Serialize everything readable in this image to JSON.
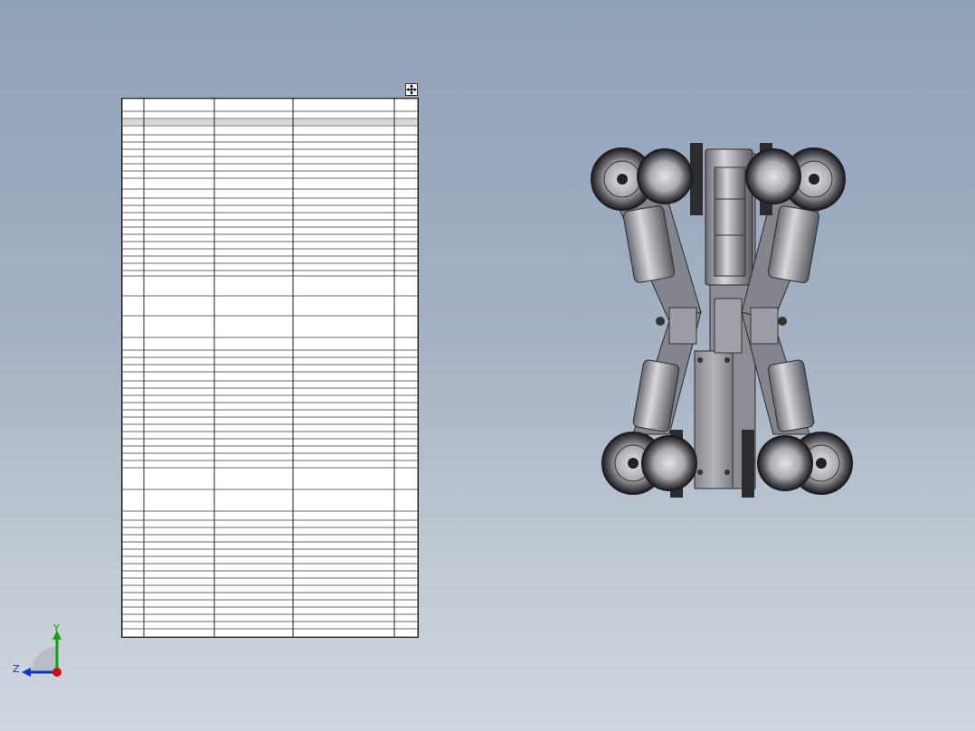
{
  "triad": {
    "x_label": "",
    "y_label": "Y",
    "z_label": "Z"
  },
  "bom": {
    "header": [
      "",
      "",
      "",
      "",
      ""
    ],
    "rows": [
      [
        "",
        "",
        "",
        "",
        ""
      ],
      [
        "",
        "",
        "",
        "",
        ""
      ],
      [
        "",
        "",
        "",
        "",
        ""
      ],
      [
        "",
        "",
        "",
        "",
        ""
      ],
      [
        "",
        "",
        "",
        "",
        ""
      ],
      [
        "",
        "",
        "",
        "",
        ""
      ],
      [
        "",
        "",
        "",
        "",
        ""
      ],
      [
        "",
        "",
        "",
        "",
        ""
      ],
      [
        "",
        "",
        "",
        "",
        ""
      ],
      [
        "",
        "",
        "",
        "",
        ""
      ],
      [
        "",
        "",
        "",
        "",
        ""
      ],
      [
        "",
        "",
        "",
        "",
        ""
      ]
    ]
  },
  "colors": {
    "background_top": "#8fa1b8",
    "background_bottom": "#d0d6de",
    "table_line": "#222222",
    "model_dark": "#2b2b30",
    "model_metal": "#9a9aa2",
    "model_light": "#c8c8cc",
    "axis_x": "#d01010",
    "axis_y": "#10a010",
    "axis_z": "#1030d0"
  },
  "icons": [
    "move-handle-icon",
    "coordinate-triad-icon"
  ]
}
